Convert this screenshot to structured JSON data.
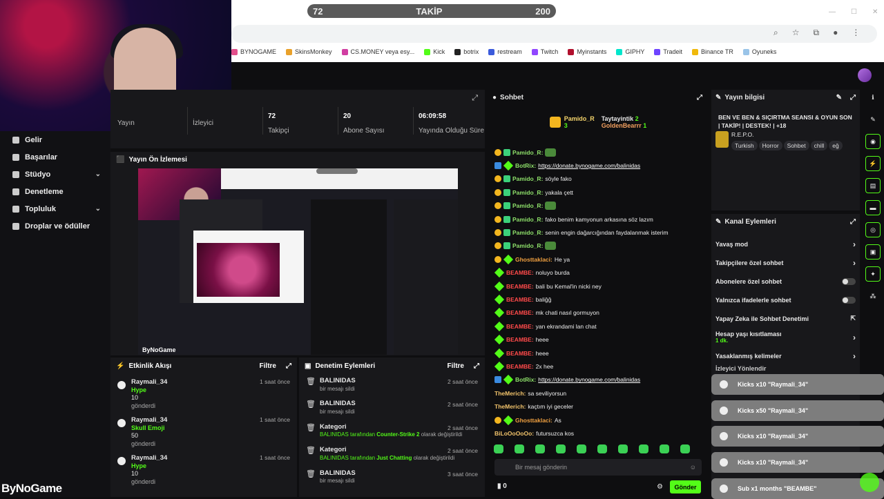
{
  "goal": {
    "left": "72",
    "label": "TAKİP",
    "right": "200"
  },
  "bookmarks": [
    {
      "label": "BYNOGAME",
      "color": "#e24f8c"
    },
    {
      "label": "SkinsMonkey",
      "color": "#e9a12b"
    },
    {
      "label": "CS.MONEY veya esy...",
      "color": "#d13ea2"
    },
    {
      "label": "Kick",
      "color": "#53fc18"
    },
    {
      "label": "botrix",
      "color": "#222"
    },
    {
      "label": "restream",
      "color": "#3b5bdb"
    },
    {
      "label": "Twitch",
      "color": "#9146ff"
    },
    {
      "label": "Myinstants",
      "color": "#b1102d"
    },
    {
      "label": "GIPHY",
      "color": "#00e6cc"
    },
    {
      "label": "Tradeit",
      "color": "#6e44ff"
    },
    {
      "label": "Binance TR",
      "color": "#f0b90b"
    },
    {
      "label": "Oyuneks",
      "color": "#9ac4e8"
    }
  ],
  "sidebar": {
    "items": [
      {
        "label": "Gelir",
        "chevron": false
      },
      {
        "label": "Başarılar",
        "chevron": false
      },
      {
        "label": "Stüdyo",
        "chevron": true
      },
      {
        "label": "Denetleme",
        "chevron": false
      },
      {
        "label": "Topluluk",
        "chevron": true
      },
      {
        "label": "Droplar ve ödüller",
        "chevron": false
      }
    ]
  },
  "stats": [
    {
      "value": "",
      "label": "Yayın"
    },
    {
      "value": "",
      "label": "İzleyici"
    },
    {
      "value": "72",
      "label": "Takipçi"
    },
    {
      "value": "20",
      "label": "Abone Sayısı"
    },
    {
      "value": "06:09:58",
      "label": "Yayında Olduğu Süre"
    }
  ],
  "preview": {
    "title": "Yayın Ön İzlemesi",
    "watermark": "ByNoGame"
  },
  "activity": {
    "title": "Etkinlik Akışı",
    "filter": "Filtre",
    "items": [
      {
        "user": "Raymali_34",
        "item": "Hype",
        "amount": "10",
        "action": "gönderdi",
        "time": "1 saat önce"
      },
      {
        "user": "Raymali_34",
        "item": "Skull Emoji",
        "amount": "50",
        "action": "gönderdi",
        "time": "1 saat önce"
      },
      {
        "user": "Raymali_34",
        "item": "Hype",
        "amount": "10",
        "action": "gönderdi",
        "time": "1 saat önce"
      }
    ]
  },
  "moderation": {
    "title": "Denetim Eylemleri",
    "filter": "Filtre",
    "items": [
      {
        "head": "BALINIDAS",
        "pre": "",
        "bold": "",
        "post": "bir mesajı sildi",
        "time": "2 saat önce"
      },
      {
        "head": "BALINIDAS",
        "pre": "",
        "bold": "",
        "post": "bir mesajı sildi",
        "time": "2 saat önce"
      },
      {
        "head": "Kategori",
        "pre": "BALINIDAS tarafından ",
        "bold": "Counter-Strike 2",
        "post": " olarak değiştirildi",
        "time": "2 saat önce"
      },
      {
        "head": "Kategori",
        "pre": "BALINIDAS tarafından ",
        "bold": "Just Chatting",
        "post": " olarak değiştirildi",
        "time": "2 saat önce"
      },
      {
        "head": "BALINIDAS",
        "pre": "",
        "bold": "",
        "post": "bir mesajı sildi",
        "time": "3 saat önce"
      }
    ]
  },
  "chat": {
    "title": "Sohbet",
    "pinned": {
      "user1": "Pamido_R",
      "count1": "3",
      "user2": "Taytayintik",
      "count2": "2",
      "user3": "GoldenBearrr",
      "count3": "1"
    },
    "messages": [
      {
        "badges": [
          "b1",
          "b2"
        ],
        "user": "Pamido_R:",
        "color": "#8ee06a",
        "text": "",
        "link": false,
        "emote": true
      },
      {
        "badges": [
          "b4",
          "b3"
        ],
        "user": "BotRix:",
        "color": "#8ee06a",
        "text": "https://donate.bynogame.com/balinidas",
        "link": true,
        "emote": false
      },
      {
        "badges": [
          "b1",
          "b2"
        ],
        "user": "Pamido_R:",
        "color": "#8ee06a",
        "text": "söyle fako",
        "link": false,
        "emote": false
      },
      {
        "badges": [
          "b1",
          "b2"
        ],
        "user": "Pamido_R:",
        "color": "#8ee06a",
        "text": "yakala çett",
        "link": false,
        "emote": false
      },
      {
        "badges": [
          "b1",
          "b2"
        ],
        "user": "Pamido_R:",
        "color": "#8ee06a",
        "text": "",
        "link": false,
        "emote": true
      },
      {
        "badges": [
          "b1",
          "b2"
        ],
        "user": "Pamido_R:",
        "color": "#8ee06a",
        "text": "fako benim kamyonun arkasına söz lazım",
        "link": false,
        "emote": false
      },
      {
        "badges": [
          "b1",
          "b2"
        ],
        "user": "Pamido_R:",
        "color": "#8ee06a",
        "text": "senin engin dağarcığından faydalanmak isterim",
        "link": false,
        "emote": false
      },
      {
        "badges": [
          "b1",
          "b2"
        ],
        "user": "Pamido_R:",
        "color": "#8ee06a",
        "text": "",
        "link": false,
        "emote": true
      },
      {
        "badges": [
          "b1",
          "b3"
        ],
        "user": "Ghosttaklaci:",
        "color": "#f0a040",
        "text": "He ya",
        "link": false,
        "emote": false
      },
      {
        "badges": [
          "b3"
        ],
        "user": "BEAMBE:",
        "color": "#ff4a4a",
        "text": "noluyo burda",
        "link": false,
        "emote": false
      },
      {
        "badges": [
          "b3"
        ],
        "user": "BEAMBE:",
        "color": "#ff4a4a",
        "text": "bali bu Kemal'in nicki ney",
        "link": false,
        "emote": false
      },
      {
        "badges": [
          "b3"
        ],
        "user": "BEAMBE:",
        "color": "#ff4a4a",
        "text": "baliğğ",
        "link": false,
        "emote": false
      },
      {
        "badges": [
          "b3"
        ],
        "user": "BEAMBE:",
        "color": "#ff4a4a",
        "text": "mk chati nasıl gormuyon",
        "link": false,
        "emote": false
      },
      {
        "badges": [
          "b3"
        ],
        "user": "BEAMBE:",
        "color": "#ff4a4a",
        "text": "yan ekrandami lan chat",
        "link": false,
        "emote": false
      },
      {
        "badges": [
          "b3"
        ],
        "user": "BEAMBE:",
        "color": "#ff4a4a",
        "text": "heee",
        "link": false,
        "emote": false
      },
      {
        "badges": [
          "b3"
        ],
        "user": "BEAMBE:",
        "color": "#ff4a4a",
        "text": "heee",
        "link": false,
        "emote": false
      },
      {
        "badges": [
          "b3"
        ],
        "user": "BEAMBE:",
        "color": "#ff4a4a",
        "text": "2x hee",
        "link": false,
        "emote": false
      },
      {
        "badges": [
          "b4",
          "b3"
        ],
        "user": "BotRix:",
        "color": "#8ee06a",
        "text": "https://donate.bynogame.com/balinidas",
        "link": true,
        "emote": false
      },
      {
        "badges": [],
        "user": "TheMerich:",
        "color": "#f2c36b",
        "text": "sa seviliyorsun",
        "link": false,
        "emote": false
      },
      {
        "badges": [],
        "user": "TheMerich:",
        "color": "#f2c36b",
        "text": "kaçtım iyi geceler",
        "link": false,
        "emote": false
      },
      {
        "badges": [
          "b1",
          "b3"
        ],
        "user": "Ghosttaklaci:",
        "color": "#f0a040",
        "text": "As",
        "link": false,
        "emote": false
      },
      {
        "badges": [],
        "user": "BiLoOoOoOo:",
        "color": "#f2c36b",
        "text": "futursuzca kos",
        "link": false,
        "emote": false
      }
    ],
    "input_placeholder": "Bir mesaj gönderin",
    "points": "0",
    "send_label": "Gönder"
  },
  "stream_info": {
    "panel_title": "Yayın bilgisi",
    "title": "BEN VE BEN & SIÇIRTMA SEANSI & OYUN SON | TAKİP! | DESTEK! | +18",
    "category": "R.E.P.O.",
    "tags": [
      "Turkish",
      "Horror",
      "Sohbet",
      "chill",
      "eğ"
    ]
  },
  "channel_actions": {
    "title": "Kanal Eylemleri",
    "rows": [
      {
        "label": "Yavaş mod",
        "control": "chevron",
        "sub": ""
      },
      {
        "label": "Takipçilere özel sohbet",
        "control": "chevron",
        "sub": ""
      },
      {
        "label": "Abonelere özel sohbet",
        "control": "toggle",
        "sub": ""
      },
      {
        "label": "Yalnızca ifadelerle sohbet",
        "control": "toggle",
        "sub": ""
      },
      {
        "label": "Yapay Zeka ile Sohbet Denetimi",
        "control": "external",
        "sub": ""
      },
      {
        "label": "Hesap yaşı kısıtlaması",
        "control": "chevron",
        "sub": "1 dk."
      },
      {
        "label": "Yasaklanmış kelimeler",
        "control": "chevron",
        "sub": ""
      }
    ],
    "partial": "İzleyici Yönlendir"
  },
  "alerts": [
    {
      "text": "Kicks x10 \"Raymali_34\""
    },
    {
      "text": "Kicks x50 \"Raymali_34\""
    },
    {
      "text": "Kicks x10 \"Raymali_34\""
    },
    {
      "text": "Kicks x10 \"Raymali_34\""
    },
    {
      "text": "Sub x1 months \"BEAMBE\""
    }
  ],
  "logo": "ByNoGame"
}
